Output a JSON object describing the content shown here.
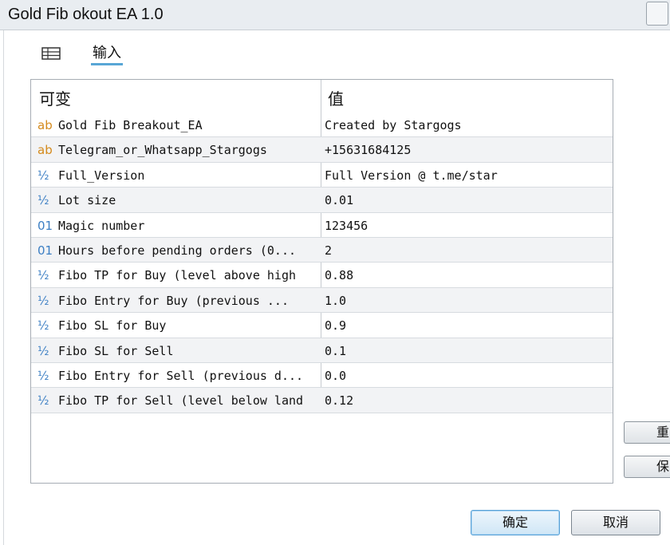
{
  "window": {
    "title": "Gold Fib     okout EA 1.0"
  },
  "tabs": [
    {
      "icon": "settings-grid-icon",
      "label": ""
    },
    {
      "icon": "",
      "label": "输入"
    }
  ],
  "table": {
    "headers": {
      "name": "可变",
      "value": "值"
    },
    "rows": [
      {
        "type": "ab",
        "type_glyph": "ab",
        "name": "Gold Fib Breakout_EA",
        "value": "Created by Stargogs"
      },
      {
        "type": "ab",
        "type_glyph": "ab",
        "name": "Telegram_or_Whatsapp_Stargogs",
        "value": "+15631684125"
      },
      {
        "type": "frac",
        "type_glyph": "½",
        "name": "Full_Version",
        "value": "Full Version @ t.me/star"
      },
      {
        "type": "frac",
        "type_glyph": "½",
        "name": "Lot size",
        "value": "0.01"
      },
      {
        "type": "int",
        "type_glyph": "01",
        "name": "Magic number",
        "value": "123456"
      },
      {
        "type": "int",
        "type_glyph": "01",
        "name": "Hours before pending orders (0...",
        "value": "2"
      },
      {
        "type": "frac",
        "type_glyph": "½",
        "name": "Fibo TP for Buy (level above high",
        "value": "0.88"
      },
      {
        "type": "frac",
        "type_glyph": "½",
        "name": "Fibo Entry for Buy (previous ...",
        "value": "1.0"
      },
      {
        "type": "frac",
        "type_glyph": "½",
        "name": "Fibo SL for Buy",
        "value": "0.9"
      },
      {
        "type": "frac",
        "type_glyph": "½",
        "name": "Fibo SL for Sell",
        "value": "0.1"
      },
      {
        "type": "frac",
        "type_glyph": "½",
        "name": "Fibo Entry for Sell (previous d...",
        "value": "0.0"
      },
      {
        "type": "frac",
        "type_glyph": "½",
        "name": "Fibo TP for Sell (level below land",
        "value": "0.12"
      }
    ]
  },
  "buttons": {
    "ok_label": "确定",
    "cancel_label": "取消",
    "side_1_label": "重",
    "side_2_label": "保"
  },
  "colors": {
    "accent": "#58a6d6",
    "ab_icon": "#d48a1c",
    "num_icon": "#3c7fc4"
  }
}
